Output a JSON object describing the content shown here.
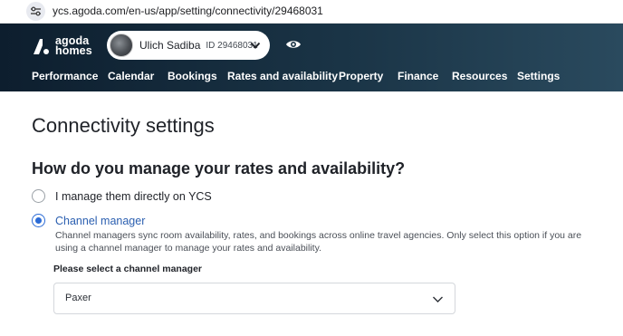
{
  "browser": {
    "url": "ycs.agoda.com/en-us/app/setting/connectivity/29468031"
  },
  "header": {
    "brand_line1": "agoda",
    "brand_line2": "homes",
    "account": {
      "name": "Ulich Sadiba",
      "id_label": "ID 29468031"
    },
    "nav": [
      {
        "label": "Performance"
      },
      {
        "label": "Calendar"
      },
      {
        "label": "Bookings"
      },
      {
        "label": "Rates and availability"
      },
      {
        "label": "Property"
      },
      {
        "label": "Finance"
      },
      {
        "label": "Resources"
      },
      {
        "label": "Settings"
      }
    ]
  },
  "main": {
    "title": "Connectivity settings",
    "question": "How do you manage your rates and availability?",
    "options": [
      {
        "label": "I manage them directly on YCS",
        "selected": false
      },
      {
        "label": "Channel manager",
        "selected": true
      }
    ],
    "channel_manager_description": "Channel managers sync room availability, rates, and bookings across online travel agencies. Only select this option if you are using a channel manager to manage your rates and availability.",
    "select_label": "Please select a channel manager",
    "selected_channel_manager": "Paxer"
  },
  "colors": {
    "header_dark": "#0d1e2e",
    "accent_blue": "#2b6bd6"
  },
  "icons": {
    "site": "site-settings-icon",
    "brand": "agoda-homes-logo",
    "account_chevron": "chevron-down-icon",
    "visibility": "eye-icon",
    "select_chevron": "chevron-down-icon"
  }
}
